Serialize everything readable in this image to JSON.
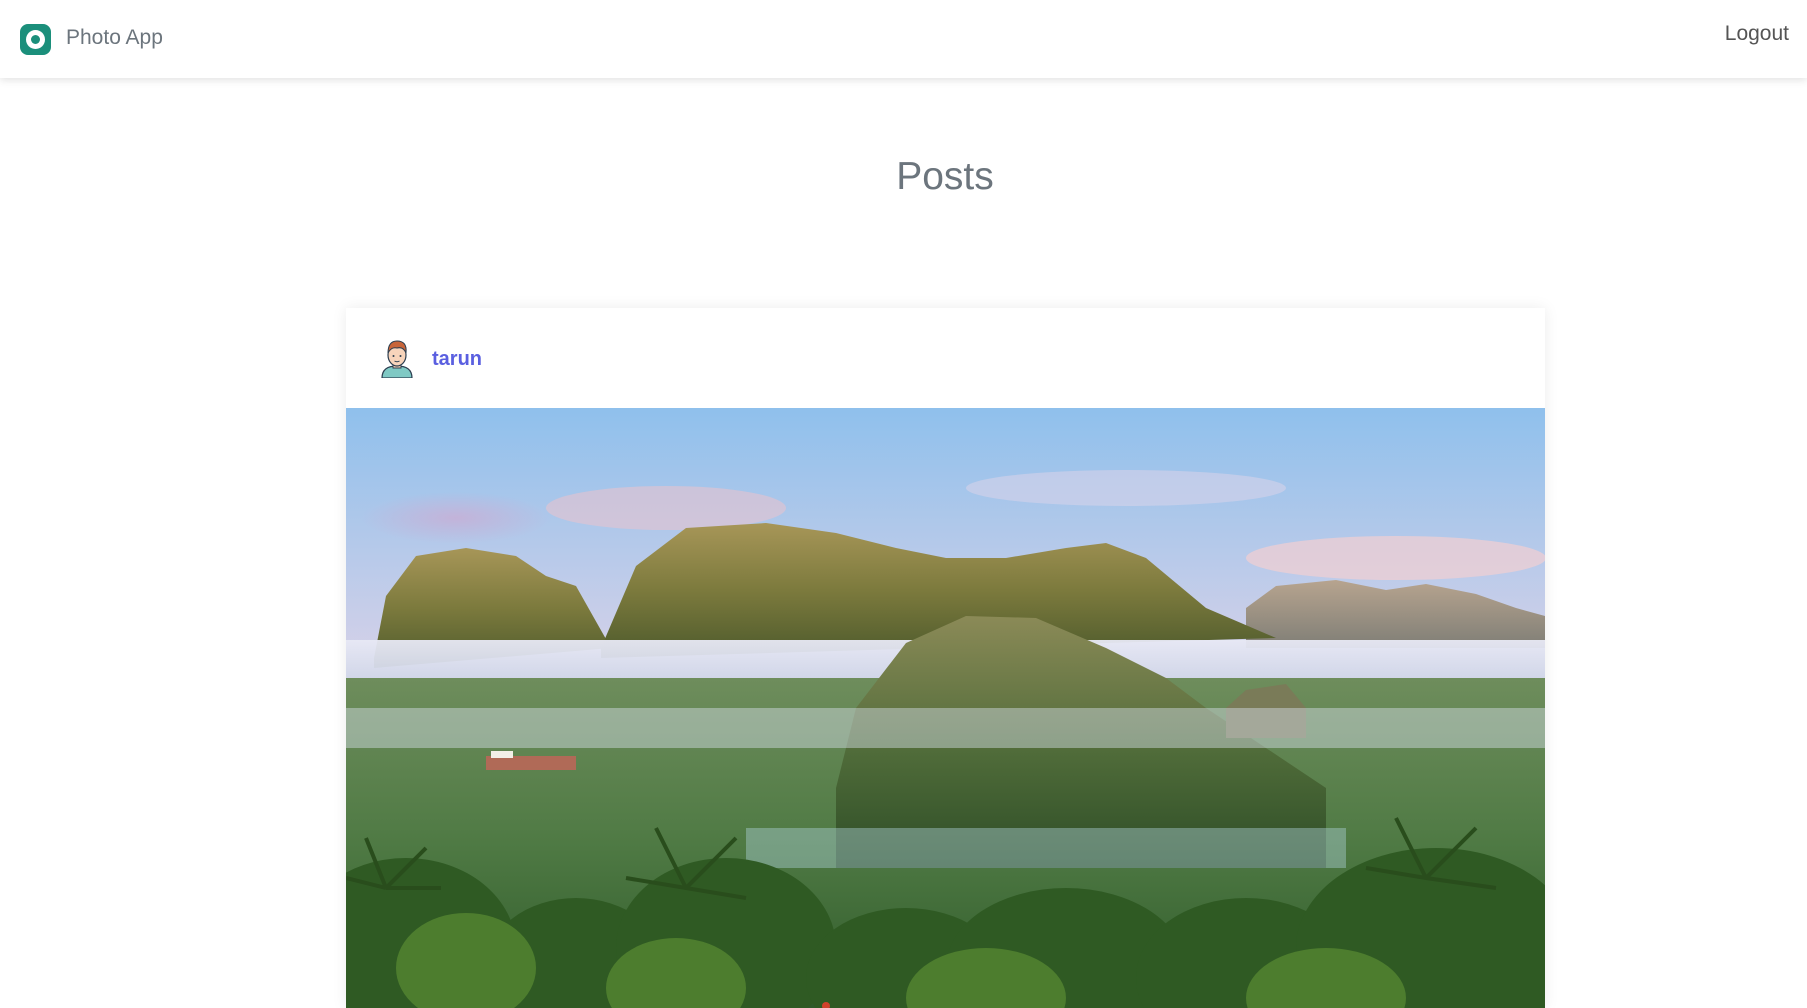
{
  "navbar": {
    "brand_name": "Photo App",
    "logout_label": "Logout",
    "brand_color": "#1b8f7b"
  },
  "main": {
    "title": "Posts"
  },
  "posts": [
    {
      "username": "tarun",
      "username_color": "#5a5fe0",
      "avatar_icon": "person-avatar-icon",
      "image_subject": "landscape-photo"
    }
  ]
}
